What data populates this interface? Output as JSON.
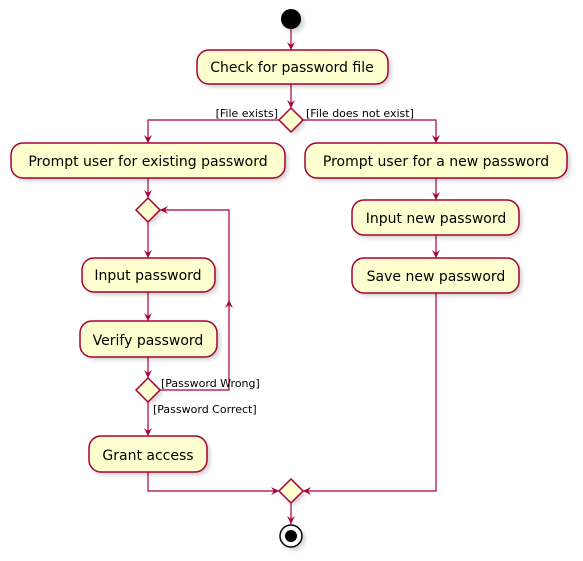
{
  "colors": {
    "node_fill": "#FEFECE",
    "border": "#A80036",
    "arrow": "#A80036"
  },
  "actions": {
    "check_file": "Check for password file",
    "prompt_existing": "Prompt user for existing password",
    "prompt_new": "Prompt user for a new password",
    "input_new": "Input new password",
    "save_new": "Save new password",
    "input_password": "Input password",
    "verify_password": "Verify password",
    "grant_access": "Grant access"
  },
  "guards": {
    "file_exists": "[File exists]",
    "file_not_exist": "[File does not exist]",
    "password_wrong": "[Password Wrong]",
    "password_correct": "[Password Correct]"
  }
}
